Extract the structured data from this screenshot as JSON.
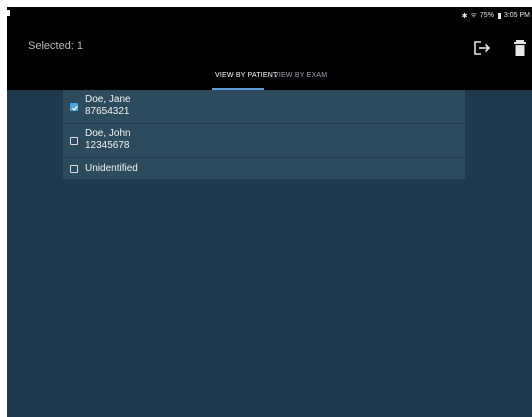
{
  "status": {
    "bluetooth_icon": "bluetooth-icon",
    "wifi_icon": "wifi-icon",
    "battery": "75%",
    "time": "3:05 PM"
  },
  "appbar": {
    "selected_label": "Selected: 1",
    "export_icon": "export-icon",
    "delete_icon": "trash-icon"
  },
  "tabs": [
    {
      "label": "VIEW BY PATIENT",
      "active": true
    },
    {
      "label": "VIEW BY EXAM",
      "active": false
    }
  ],
  "patients": [
    {
      "name": "Doe, Jane",
      "id": "87654321",
      "checked": true
    },
    {
      "name": "Doe, John",
      "id": "12345678",
      "checked": false
    },
    {
      "name": "Unidentified",
      "id": "",
      "checked": false
    }
  ],
  "colors": {
    "background": "#1f3a4f",
    "row": "#2e4b5e",
    "accent": "#4ea3e2",
    "bar": "#000000"
  }
}
